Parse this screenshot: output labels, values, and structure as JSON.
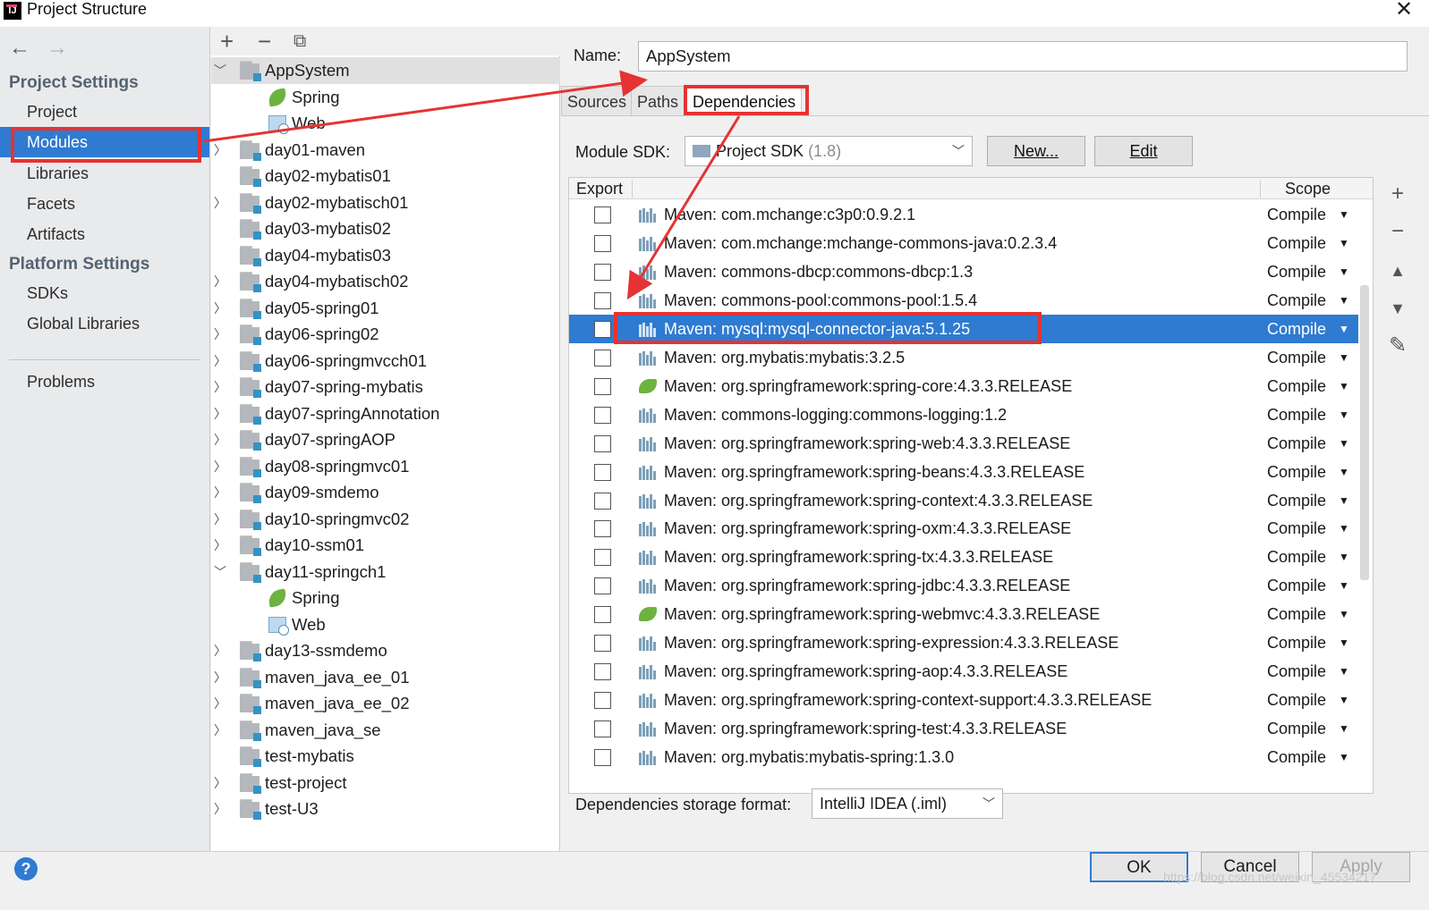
{
  "window": {
    "title": "Project Structure",
    "app_icon": "intellij-idea-icon"
  },
  "nav": {
    "back_icon": "←",
    "forward_icon": "→",
    "project_settings": "Project Settings",
    "project_items": [
      "Project",
      "Modules",
      "Libraries",
      "Facets",
      "Artifacts"
    ],
    "platform_settings": "Platform Settings",
    "platform_items": [
      "SDKs",
      "Global Libraries"
    ],
    "problems": "Problems",
    "selected": "Modules"
  },
  "tree": {
    "rows": [
      {
        "label": "AppSystem",
        "type": "module",
        "expanded": true,
        "selected": true
      },
      {
        "label": "Spring",
        "type": "spring"
      },
      {
        "label": "Web",
        "type": "web"
      },
      {
        "label": "day01-maven",
        "type": "module",
        "expandable": true
      },
      {
        "label": "day02-mybatis01",
        "type": "module"
      },
      {
        "label": "day02-mybatisch01",
        "type": "module",
        "expandable": true
      },
      {
        "label": "day03-mybatis02",
        "type": "module"
      },
      {
        "label": "day04-mybatis03",
        "type": "module"
      },
      {
        "label": "day04-mybatisch02",
        "type": "module",
        "expandable": true
      },
      {
        "label": "day05-spring01",
        "type": "module",
        "expandable": true
      },
      {
        "label": "day06-spring02",
        "type": "module",
        "expandable": true
      },
      {
        "label": "day06-springmvcch01",
        "type": "module",
        "expandable": true
      },
      {
        "label": "day07-spring-mybatis",
        "type": "module",
        "expandable": true
      },
      {
        "label": "day07-springAnnotation",
        "type": "module",
        "expandable": true
      },
      {
        "label": "day07-springAOP",
        "type": "module",
        "expandable": true
      },
      {
        "label": "day08-springmvc01",
        "type": "module",
        "expandable": true
      },
      {
        "label": "day09-smdemo",
        "type": "module",
        "expandable": true
      },
      {
        "label": "day10-springmvc02",
        "type": "module",
        "expandable": true
      },
      {
        "label": "day10-ssm01",
        "type": "module",
        "expandable": true
      },
      {
        "label": "day11-springch1",
        "type": "module",
        "expanded": true
      },
      {
        "label": "Spring",
        "type": "spring"
      },
      {
        "label": "Web",
        "type": "web"
      },
      {
        "label": "day13-ssmdemo",
        "type": "module",
        "expandable": true
      },
      {
        "label": "maven_java_ee_01",
        "type": "module",
        "expandable": true
      },
      {
        "label": "maven_java_ee_02",
        "type": "module",
        "expandable": true
      },
      {
        "label": "maven_java_se",
        "type": "module",
        "expandable": true
      },
      {
        "label": "test-mybatis",
        "type": "module"
      },
      {
        "label": "test-project",
        "type": "module",
        "expandable": true
      },
      {
        "label": "test-U3",
        "type": "module",
        "expandable": true
      }
    ]
  },
  "module": {
    "name_label": "Name:",
    "name_value": "AppSystem",
    "tabs": [
      "Sources",
      "Paths",
      "Dependencies"
    ],
    "active_tab": "Dependencies",
    "sdk_label": "Module SDK:",
    "sdk_value": "Project SDK",
    "sdk_version": "(1.8)",
    "new_button": "New...",
    "edit_button": "Edit"
  },
  "deps": {
    "header_export": "Export",
    "header_scope": "Scope",
    "scope_value": "Compile",
    "rows": [
      {
        "name": "Maven: com.mchange:c3p0:0.9.2.1",
        "icon": "maven"
      },
      {
        "name": "Maven: com.mchange:mchange-commons-java:0.2.3.4",
        "icon": "maven"
      },
      {
        "name": "Maven: commons-dbcp:commons-dbcp:1.3",
        "icon": "maven"
      },
      {
        "name": "Maven: commons-pool:commons-pool:1.5.4",
        "icon": "maven"
      },
      {
        "name": "Maven: mysql:mysql-connector-java:5.1.25",
        "icon": "maven",
        "selected": true
      },
      {
        "name": "Maven: org.mybatis:mybatis:3.2.5",
        "icon": "maven"
      },
      {
        "name": "Maven: org.springframework:spring-core:4.3.3.RELEASE",
        "icon": "spring"
      },
      {
        "name": "Maven: commons-logging:commons-logging:1.2",
        "icon": "maven"
      },
      {
        "name": "Maven: org.springframework:spring-web:4.3.3.RELEASE",
        "icon": "maven"
      },
      {
        "name": "Maven: org.springframework:spring-beans:4.3.3.RELEASE",
        "icon": "maven"
      },
      {
        "name": "Maven: org.springframework:spring-context:4.3.3.RELEASE",
        "icon": "maven"
      },
      {
        "name": "Maven: org.springframework:spring-oxm:4.3.3.RELEASE",
        "icon": "maven"
      },
      {
        "name": "Maven: org.springframework:spring-tx:4.3.3.RELEASE",
        "icon": "maven"
      },
      {
        "name": "Maven: org.springframework:spring-jdbc:4.3.3.RELEASE",
        "icon": "maven"
      },
      {
        "name": "Maven: org.springframework:spring-webmvc:4.3.3.RELEASE",
        "icon": "spring"
      },
      {
        "name": "Maven: org.springframework:spring-expression:4.3.3.RELEASE",
        "icon": "maven"
      },
      {
        "name": "Maven: org.springframework:spring-aop:4.3.3.RELEASE",
        "icon": "maven"
      },
      {
        "name": "Maven: org.springframework:spring-context-support:4.3.3.RELEASE",
        "icon": "maven"
      },
      {
        "name": "Maven: org.springframework:spring-test:4.3.3.RELEASE",
        "icon": "maven"
      },
      {
        "name": "Maven: org.mybatis:mybatis-spring:1.3.0",
        "icon": "maven"
      }
    ],
    "storage_label": "Dependencies storage format:",
    "storage_value": "IntelliJ IDEA (.iml)"
  },
  "footer": {
    "ok": "OK",
    "cancel": "Cancel",
    "apply": "Apply",
    "help_icon": "?",
    "watermark": "https://blog.csdn.net/weixin_45534217"
  },
  "colors": {
    "selection": "#2f7bd1",
    "annotation": "#e53333",
    "spring_green": "#6db33f"
  }
}
